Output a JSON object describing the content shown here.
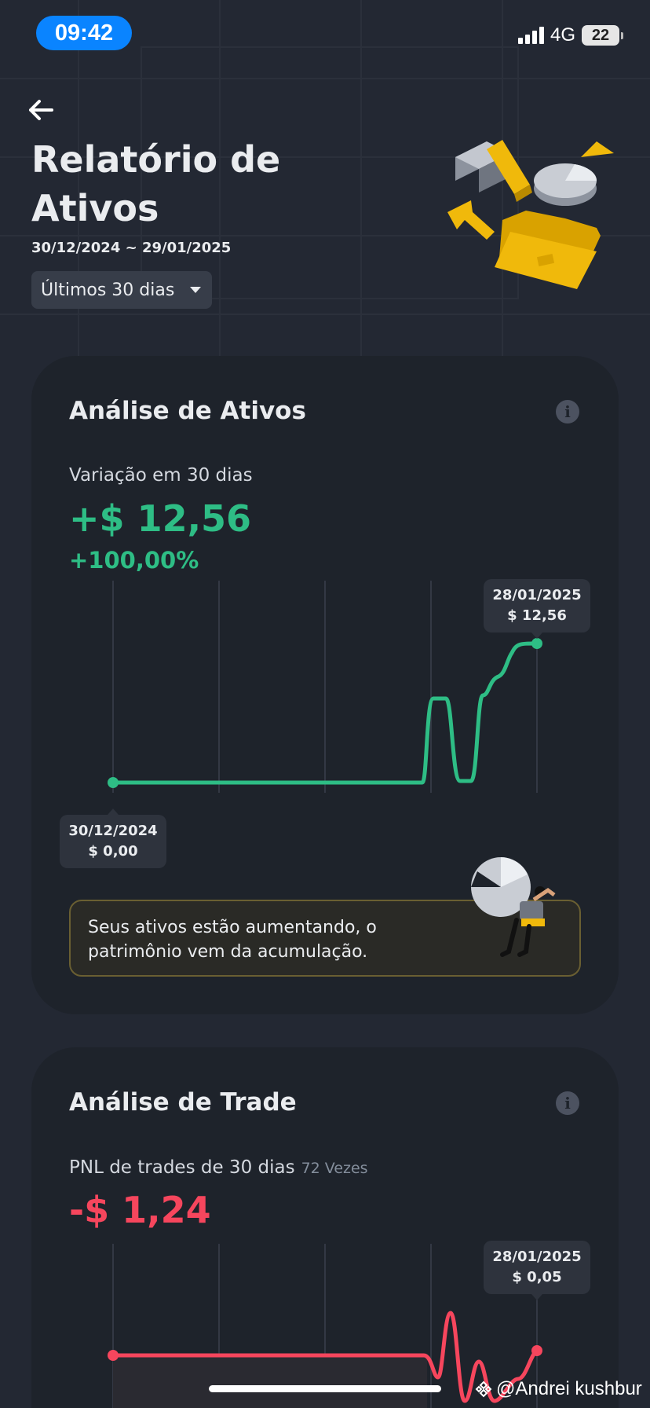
{
  "status_bar": {
    "time": "09:42",
    "network": "4G",
    "battery": "22"
  },
  "header": {
    "back_icon": "arrow-left-icon",
    "title": "Relatório de Ativos",
    "date_range": "30/12/2024 ~ 29/01/2025",
    "period_select": "Últimos 30 dias"
  },
  "asset_analysis": {
    "title": "Análise de Ativos",
    "change_label": "Variação em 30 dias",
    "change_value": "+$ 12,56",
    "change_pct": "+100,00%",
    "start_tooltip": {
      "date": "30/12/2024",
      "value": "$ 0,00"
    },
    "end_tooltip": {
      "date": "28/01/2025",
      "value": "$ 12,56"
    },
    "insight": "Seus ativos estão aumentando, o patrimônio vem da acumulação."
  },
  "trade_analysis": {
    "title": "Análise de Trade",
    "pnl_label": "PNL de trades de 30 dias",
    "pnl_count": "72 Vezes",
    "pnl_value": "-$ 1,24",
    "end_tooltip": {
      "date": "28/01/2025",
      "value": "$ 0,05"
    }
  },
  "colors": {
    "positive": "#2ebd85",
    "negative": "#f6465d",
    "accent_blue": "#0a84ff"
  },
  "watermark": "@Andrei kushbur"
}
